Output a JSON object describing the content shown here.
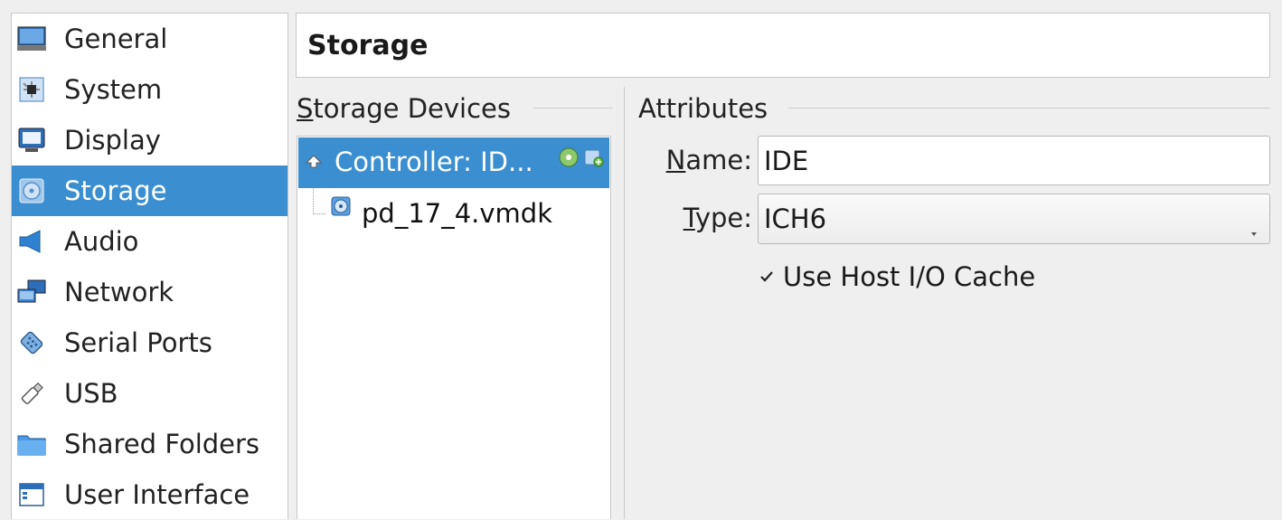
{
  "sidebar": {
    "items": [
      {
        "label": "General",
        "icon": "general-icon",
        "selected": false
      },
      {
        "label": "System",
        "icon": "system-icon",
        "selected": false
      },
      {
        "label": "Display",
        "icon": "display-icon",
        "selected": false
      },
      {
        "label": "Storage",
        "icon": "storage-icon",
        "selected": true
      },
      {
        "label": "Audio",
        "icon": "audio-icon",
        "selected": false
      },
      {
        "label": "Network",
        "icon": "network-icon",
        "selected": false
      },
      {
        "label": "Serial Ports",
        "icon": "serial-ports-icon",
        "selected": false
      },
      {
        "label": "USB",
        "icon": "usb-icon",
        "selected": false
      },
      {
        "label": "Shared Folders",
        "icon": "shared-folders-icon",
        "selected": false
      },
      {
        "label": "User Interface",
        "icon": "user-interface-icon",
        "selected": false
      }
    ]
  },
  "page": {
    "title": "Storage"
  },
  "storage_devices": {
    "header_first": "S",
    "header_rest": "torage Devices",
    "controller_label": "Controller: ID...",
    "disk_label": "pd_17_4.vmdk"
  },
  "attributes": {
    "header": "Attributes",
    "name_label_first": "N",
    "name_label_rest": "ame:",
    "name_value": "IDE",
    "type_label_first": "T",
    "type_label_rest": "ype:",
    "type_value": "ICH6",
    "host_cache_label": "Use Host I/O Cache",
    "host_cache_checked": true
  },
  "colors": {
    "selection": "#3b8fd0",
    "background": "#efefef"
  }
}
